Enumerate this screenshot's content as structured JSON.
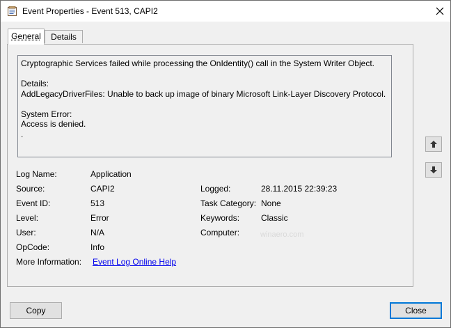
{
  "window": {
    "title": "Event Properties - Event 513, CAPI2",
    "close_glyph": "✕"
  },
  "tabs": [
    {
      "label": "General",
      "active": true
    },
    {
      "label": "Details",
      "active": false
    }
  ],
  "description": {
    "line1": "Cryptographic Services failed while processing the OnIdentity() call in the System Writer Object.",
    "line2": "Details:",
    "line3": "AddLegacyDriverFiles: Unable to back up image of binary Microsoft Link-Layer Discovery Protocol.",
    "line4": "System Error:",
    "line5": "Access is denied.",
    "line6": "."
  },
  "fields": {
    "log_name": {
      "label": "Log Name:",
      "value": "Application"
    },
    "source": {
      "label": "Source:",
      "value": "CAPI2"
    },
    "event_id": {
      "label": "Event ID:",
      "value": "513"
    },
    "level": {
      "label": "Level:",
      "value": "Error"
    },
    "user": {
      "label": "User:",
      "value": "N/A"
    },
    "opcode": {
      "label": "OpCode:",
      "value": "Info"
    },
    "more_info": {
      "label": "More Information:",
      "value": "Event Log Online Help"
    },
    "logged": {
      "label": "Logged:",
      "value": "28.11.2015 22:39:23"
    },
    "task_category": {
      "label": "Task Category:",
      "value": "None"
    },
    "keywords": {
      "label": "Keywords:",
      "value": "Classic"
    },
    "computer": {
      "label": "Computer:",
      "value": ""
    }
  },
  "watermark": "winaero.com",
  "buttons": {
    "copy": "Copy",
    "close": "Close"
  },
  "icons": {
    "app": "event-properties-icon",
    "up": "arrow-up-icon",
    "down": "arrow-down-icon"
  }
}
